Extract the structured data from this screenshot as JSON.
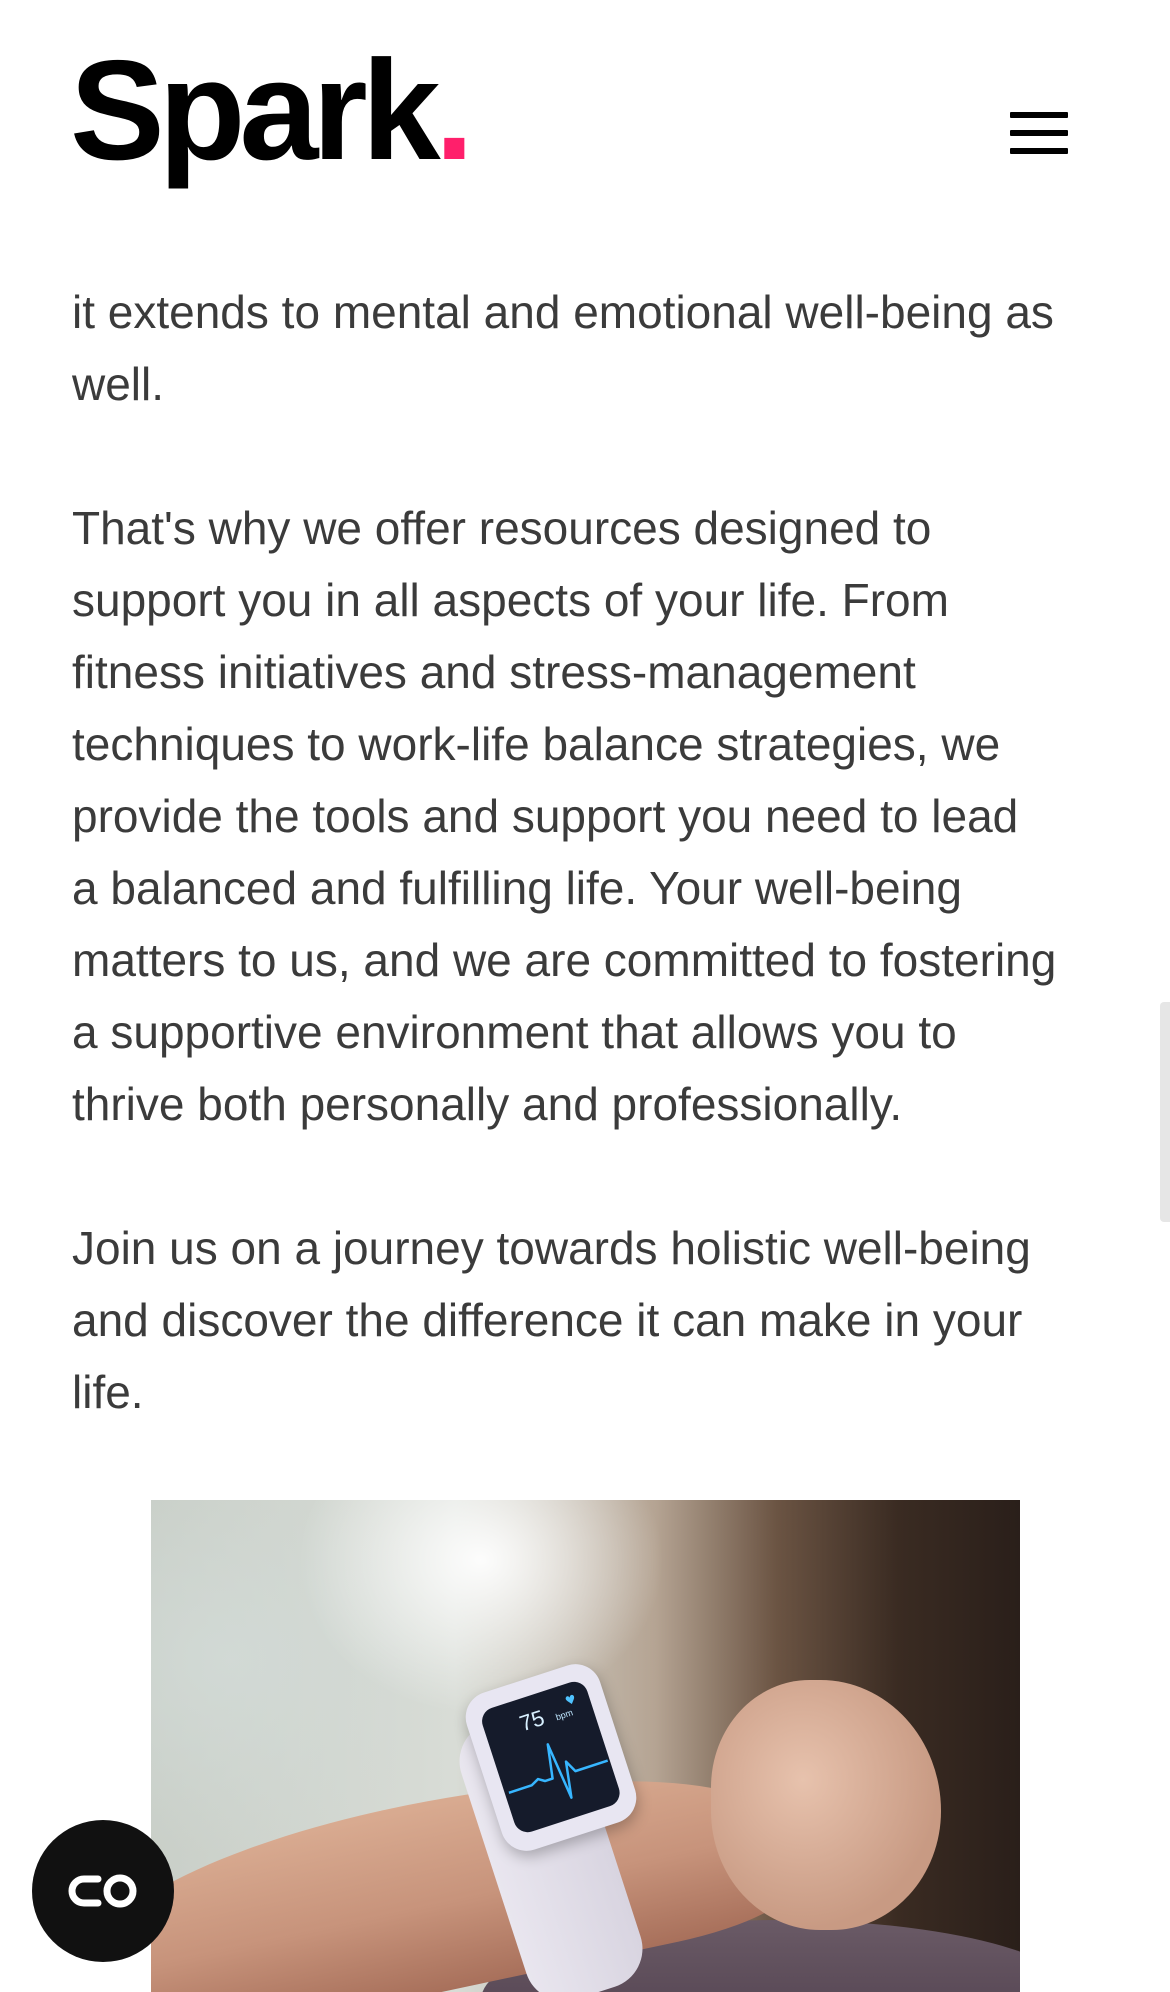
{
  "header": {
    "logo_text": "Spark",
    "logo_dot": ".",
    "accent_color": "#ff1f6b",
    "menu_icon": "hamburger-menu-icon"
  },
  "article": {
    "paragraph_1": [
      "it extends to mental and emotional well-being as",
      "well."
    ],
    "paragraph_2": [
      "That's why we offer resources designed to",
      "support you in all aspects of your life. From",
      "fitness initiatives and stress-management",
      "techniques to work-life balance strategies, we",
      "provide the tools and support you need to lead",
      "a balanced and fulfilling life. Your well-being",
      "matters to us, and we are committed to fostering",
      "a supportive environment that allows you to",
      "thrive both personally and professionally."
    ],
    "paragraph_3": [
      "Join us on a journey towards holistic well-being",
      "and discover the difference it can make in your",
      "life."
    ]
  },
  "image": {
    "watch_bpm": "75",
    "watch_unit": "bpm",
    "subject": "smartwatch-heart-rate-photo"
  },
  "floating_button": {
    "icon": "accessibility-toggle-icon"
  }
}
